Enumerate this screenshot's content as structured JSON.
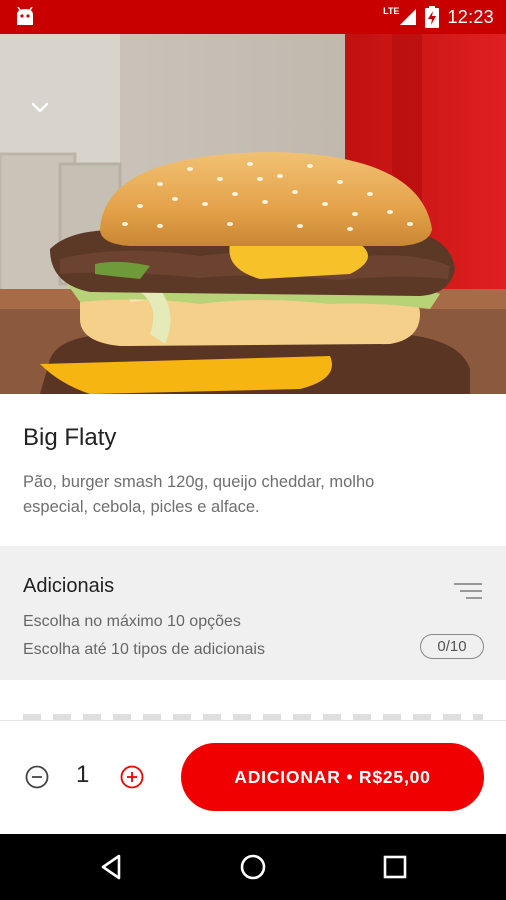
{
  "status_bar": {
    "network_label": "LTE",
    "time": "12:23",
    "icons": [
      "android-notification-icon",
      "signal-icon",
      "battery-charging-icon"
    ]
  },
  "hero": {
    "image_subject": "burger-photo",
    "collapse_icon": "chevron-down-icon"
  },
  "product": {
    "title": "Big Flaty",
    "description_line1": "Pão, burger smash 120g, queijo cheddar, molho",
    "description_line2": "especial, cebola, picles e alface."
  },
  "addons": {
    "title": "Adicionais",
    "max_options": "Escolha no máximo 10 opções",
    "max_types": "Escolha até 10 tipos de adicionais",
    "counter": "0/10",
    "filter_icon": "filter-lines-icon"
  },
  "action_bar": {
    "quantity": "1",
    "add_button_label": "ADICIONAR • R$25,00"
  },
  "nav_bar": {
    "icons": [
      "back-triangle-icon",
      "home-circle-icon",
      "recents-square-icon"
    ]
  },
  "colors": {
    "accent_red": "#f00000",
    "status_bar_red": "#c80000",
    "section_gray": "#f0f0f0"
  }
}
